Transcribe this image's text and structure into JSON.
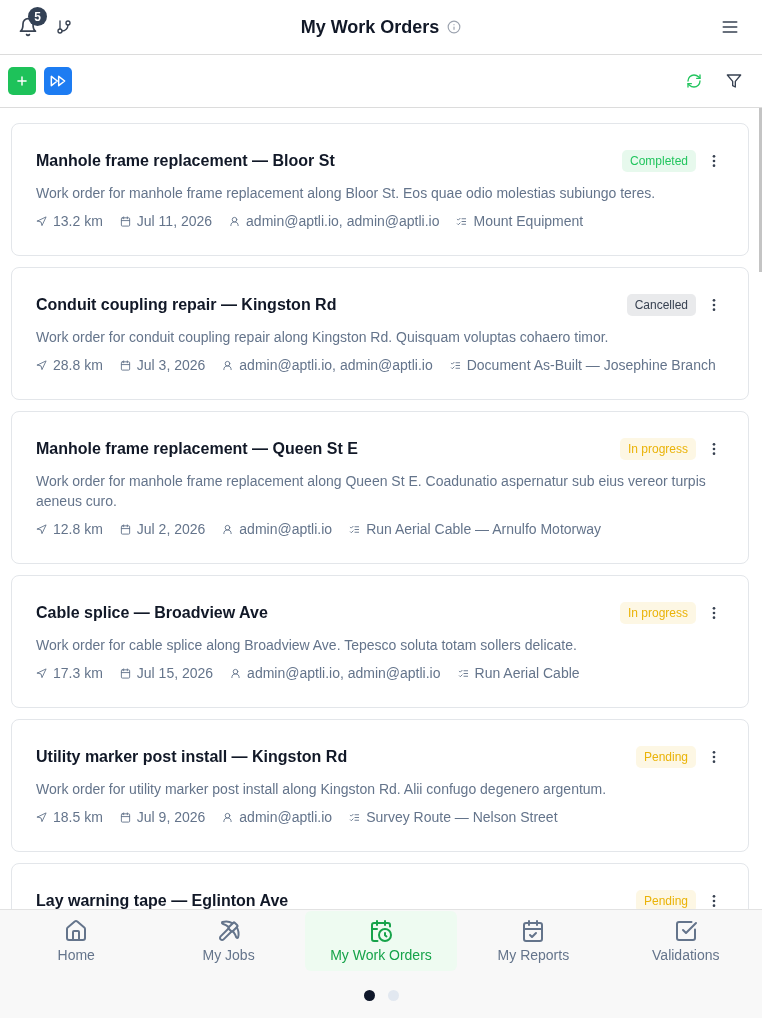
{
  "header": {
    "notification_count": "5",
    "title": "My Work Orders"
  },
  "orders": [
    {
      "title": "Manhole frame replacement — Bloor St",
      "status": {
        "label": "Completed",
        "color": "#22c55e"
      },
      "description": "Work order for manhole frame replacement along Bloor St. Eos quae odio molestias subiungo teres.",
      "distance": "13.2 km",
      "date": "Jul 11, 2026",
      "assignees": "admin@aptli.io, admin@aptli.io",
      "task": "Mount Equipment"
    },
    {
      "title": "Conduit coupling repair — Kingston Rd",
      "status": {
        "label": "Cancelled",
        "color": "#374151"
      },
      "description": "Work order for conduit coupling repair along Kingston Rd. Quisquam voluptas cohaero timor.",
      "distance": "28.8 km",
      "date": "Jul 3, 2026",
      "assignees": "admin@aptli.io, admin@aptli.io",
      "task": "Document As-Built — Josephine Branch"
    },
    {
      "title": "Manhole frame replacement — Queen St E",
      "status": {
        "label": "In progress",
        "color": "#eab308"
      },
      "description": "Work order for manhole frame replacement along Queen St E. Coadunatio aspernatur sub eius vereor turpis aeneus curo.",
      "distance": "12.8 km",
      "date": "Jul 2, 2026",
      "assignees": "admin@aptli.io",
      "task": "Run Aerial Cable — Arnulfo Motorway"
    },
    {
      "title": "Cable splice — Broadview Ave",
      "status": {
        "label": "In progress",
        "color": "#eab308"
      },
      "description": "Work order for cable splice along Broadview Ave. Tepesco soluta totam sollers delicate.",
      "distance": "17.3 km",
      "date": "Jul 15, 2026",
      "assignees": "admin@aptli.io, admin@aptli.io",
      "task": "Run Aerial Cable"
    },
    {
      "title": "Utility marker post install — Kingston Rd",
      "status": {
        "label": "Pending",
        "color": "#eab308"
      },
      "description": "Work order for utility marker post install along Kingston Rd. Alii confugo degenero argentum.",
      "distance": "18.5 km",
      "date": "Jul 9, 2026",
      "assignees": "admin@aptli.io",
      "task": "Survey Route — Nelson Street"
    },
    {
      "title": "Lay warning tape — Eglinton Ave",
      "status": {
        "label": "Pending",
        "color": "#eab308"
      }
    }
  ],
  "bottom_nav": [
    {
      "label": "Home",
      "selected": false
    },
    {
      "label": "My Jobs",
      "selected": false
    },
    {
      "label": "My Work Orders",
      "selected": true
    },
    {
      "label": "My Reports",
      "selected": false
    },
    {
      "label": "Validations",
      "selected": false
    }
  ],
  "pager": [
    {
      "selected": true
    },
    {
      "selected": false
    }
  ]
}
